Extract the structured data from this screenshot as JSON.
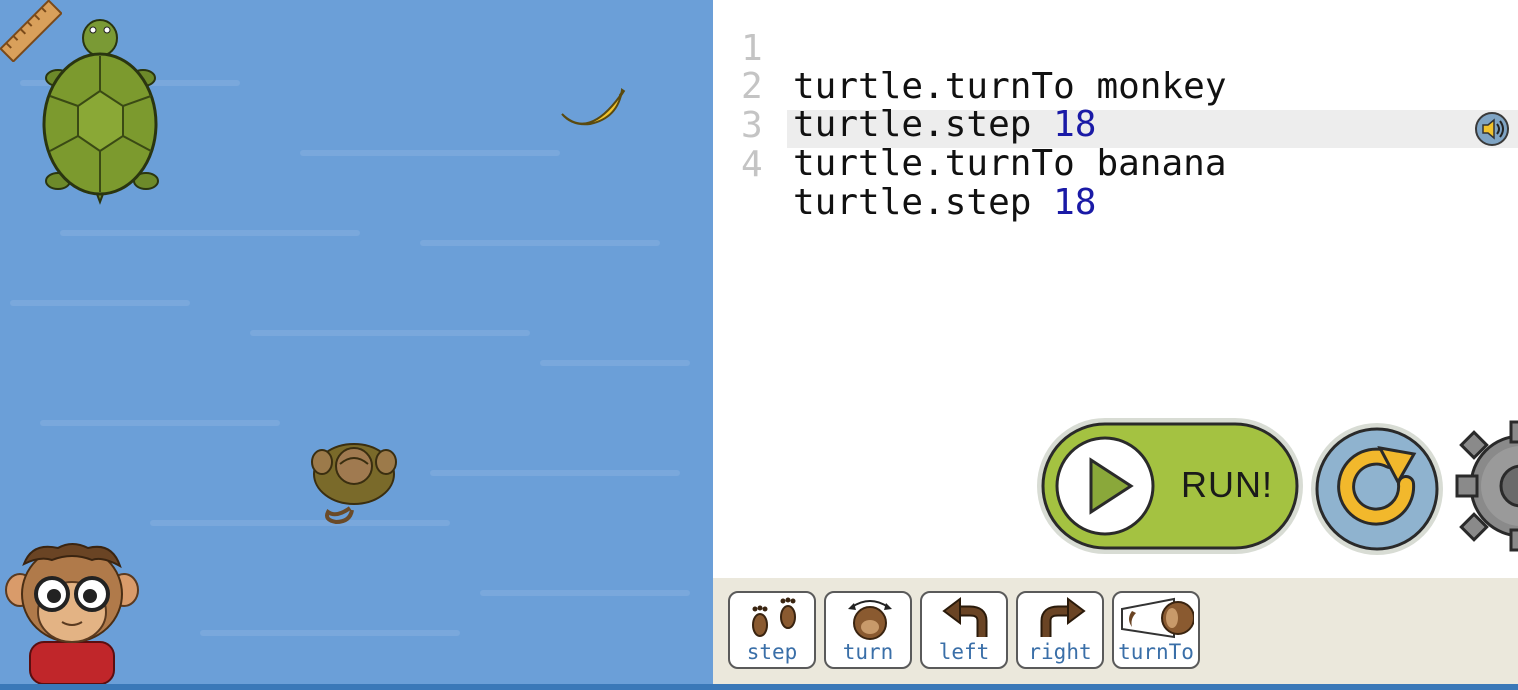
{
  "code_editor": {
    "lines": [
      {
        "number": "1",
        "object": "turtle.turnTo",
        "arg": "monkey",
        "arg_is_number": false
      },
      {
        "number": "2",
        "object": "turtle.step",
        "arg": "18",
        "arg_is_number": true
      },
      {
        "number": "3",
        "object": "turtle.turnTo",
        "arg": "banana",
        "arg_is_number": false
      },
      {
        "number": "4",
        "object": "turtle.step",
        "arg": "18",
        "arg_is_number": true
      }
    ],
    "active_line": 4
  },
  "controls": {
    "run_label": "RUN!"
  },
  "palette": {
    "blocks": [
      {
        "label": "step",
        "icon": "footprints-icon"
      },
      {
        "label": "turn",
        "icon": "monkey-turn-icon"
      },
      {
        "label": "left",
        "icon": "arrow-left-icon"
      },
      {
        "label": "right",
        "icon": "arrow-right-icon"
      },
      {
        "label": "turnTo",
        "icon": "turnto-icon"
      }
    ]
  },
  "colors": {
    "water": "#6b9fd8",
    "run_button": "#a4c241",
    "reset_button": "#8fb3cf",
    "palette_bg": "#ebe8dc",
    "number_literal": "#1a1aa6",
    "block_label": "#3a6fa8"
  }
}
